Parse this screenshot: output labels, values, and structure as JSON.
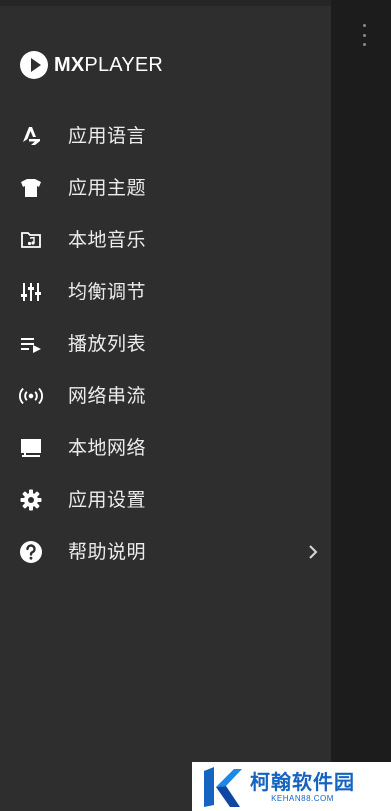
{
  "app": {
    "logo_mx": "MX",
    "logo_player": "PLAYER"
  },
  "menu": {
    "items": [
      {
        "label": "应用语言",
        "icon": "language-icon"
      },
      {
        "label": "应用主题",
        "icon": "tshirt-icon"
      },
      {
        "label": "本地音乐",
        "icon": "music-folder-icon"
      },
      {
        "label": "均衡调节",
        "icon": "equalizer-icon"
      },
      {
        "label": "播放列表",
        "icon": "playlist-icon"
      },
      {
        "label": "网络串流",
        "icon": "stream-icon"
      },
      {
        "label": "本地网络",
        "icon": "computer-icon"
      },
      {
        "label": "应用设置",
        "icon": "gear-icon"
      },
      {
        "label": "帮助说明",
        "icon": "help-icon",
        "has_submenu": true
      }
    ]
  },
  "watermark": {
    "main": "柯翰软件园",
    "sub": "KEHAN88.COM"
  },
  "colors": {
    "drawer_bg": "#2e2e2e",
    "background": "#1b1b1b",
    "text": "#ececec",
    "watermark_blue": "#1565c0"
  }
}
